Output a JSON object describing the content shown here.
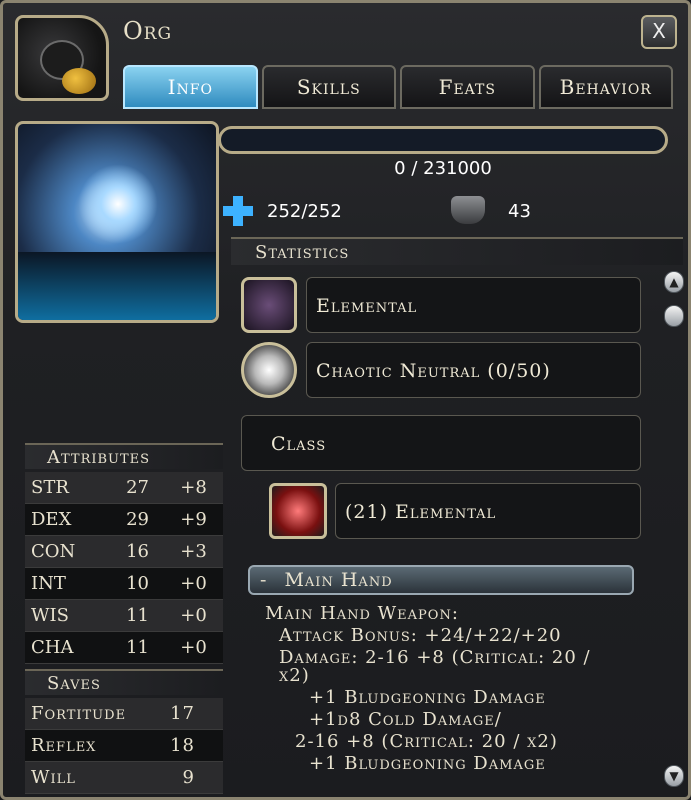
{
  "window": {
    "title": "Org",
    "close_label": "X"
  },
  "tabs": [
    {
      "label": "Info",
      "active": true
    },
    {
      "label": "Skills",
      "active": false
    },
    {
      "label": "Feats",
      "active": false
    },
    {
      "label": "Behavior",
      "active": false
    }
  ],
  "xp": {
    "text": "0 / 231000",
    "fill": 0
  },
  "vitals": {
    "hp": "252/252",
    "ac": "43"
  },
  "statistics": {
    "header": "Statistics",
    "race": "Elemental",
    "alignment": "Chaotic Neutral (0/50)",
    "class_label": "Class",
    "class_value": "(21) Elemental"
  },
  "main_hand": {
    "header_icon": "-",
    "header": "Main Hand",
    "lines": [
      "Main Hand Weapon:",
      "Attack Bonus: +24/+22/+20",
      "Damage: 2-16 +8 (Critical: 20 /",
      "x2)",
      "+1 Bludgeoning Damage",
      "+1d8 Cold Damage/",
      "2-16 +8 (Critical: 20 / x2)",
      "+1 Bludgeoning Damage"
    ]
  },
  "attributes": {
    "header": "Attributes",
    "rows": [
      {
        "name": "STR",
        "score": "27",
        "mod": "+8"
      },
      {
        "name": "DEX",
        "score": "29",
        "mod": "+9"
      },
      {
        "name": "CON",
        "score": "16",
        "mod": "+3"
      },
      {
        "name": "INT",
        "score": "10",
        "mod": "+0"
      },
      {
        "name": "WIS",
        "score": "11",
        "mod": "+0"
      },
      {
        "name": "CHA",
        "score": "11",
        "mod": "+0"
      }
    ]
  },
  "saves": {
    "header": "Saves",
    "rows": [
      {
        "name": "Fortitude",
        "value": "17"
      },
      {
        "name": "Reflex",
        "value": "18"
      },
      {
        "name": "Will",
        "value": "9"
      }
    ]
  },
  "icons": {
    "hp": "plus-icon",
    "ac": "armor-icon",
    "race": "elemental-rune-icon",
    "alignment": "alignment-medallion-icon",
    "class": "elemental-class-icon"
  },
  "colors": {
    "active_tab": "#5fb8e4",
    "accent_gold": "#b7ab88",
    "hp_blue": "#3db2ff"
  }
}
